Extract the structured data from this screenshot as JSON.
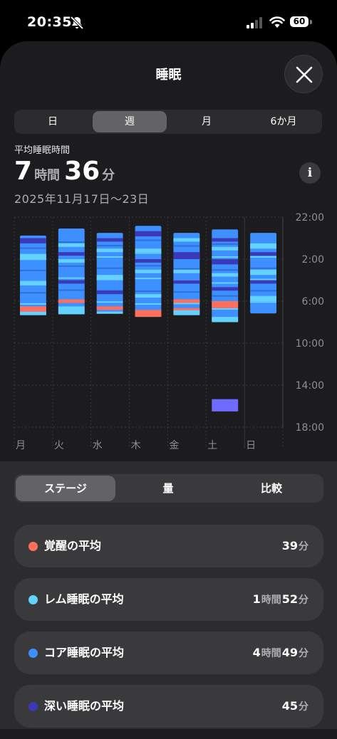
{
  "status_bar": {
    "time": "20:35",
    "battery": "60"
  },
  "header": {
    "title": "睡眠"
  },
  "period_tabs": [
    "日",
    "週",
    "月",
    "6か月"
  ],
  "summary": {
    "label": "平均睡眠時間",
    "hours": "7",
    "hours_unit": "時間",
    "minutes": "36",
    "minutes_unit": "分",
    "date_range": "2025年11月17日〜23日"
  },
  "chart_data": {
    "type": "bar",
    "categories": [
      "月",
      "火",
      "水",
      "木",
      "金",
      "土",
      "日"
    ],
    "y_ticks": [
      "22:00",
      "2:00",
      "6:00",
      "10:00",
      "14:00",
      "18:00"
    ],
    "ylim": [
      "22:00",
      "20:00"
    ],
    "series": [
      {
        "stage": "awake",
        "color": "#ff6f5b"
      },
      {
        "stage": "rem",
        "color": "#64d2ff"
      },
      {
        "stage": "core",
        "color": "#3e8fff"
      },
      {
        "stage": "deep",
        "color": "#3a3ab8"
      }
    ],
    "sessions": [
      {
        "day": "月",
        "start": "23:45",
        "end": "7:20",
        "awake": [
          "6:30-7:00"
        ],
        "rem": [
          "1:30-2:00",
          "4:10-4:30",
          "7:00-7:20"
        ],
        "deep": [
          "0:00-0:30"
        ]
      },
      {
        "day": "火",
        "start": "23:05",
        "end": "7:15",
        "awake": [
          "5:50-6:10"
        ],
        "rem": [
          "0:30-0:50",
          "2:00-2:20",
          "6:30-7:15"
        ],
        "deep": [
          "1:20-1:40",
          "4:00-4:20"
        ]
      },
      {
        "day": "水",
        "start": "23:30",
        "end": "7:10",
        "awake": [
          "6:30-6:50"
        ],
        "rem": [
          "1:00-1:20",
          "3:30-4:00",
          "7:00-7:10"
        ],
        "deep": [
          "0:00-0:20",
          "5:00-5:20"
        ]
      },
      {
        "day": "木",
        "start": "22:50",
        "end": "7:30",
        "awake": [
          "6:50-7:30"
        ],
        "rem": [
          "1:00-1:20",
          "3:00-3:20",
          "5:20-5:40"
        ],
        "deep": [
          "23:20-23:50",
          "2:00-2:20"
        ]
      },
      {
        "day": "金",
        "start": "23:30",
        "end": "7:20",
        "awake": [
          "5:50-6:10",
          "6:40-6:50"
        ],
        "rem": [
          "0:00-0:20",
          "3:00-3:20",
          "6:50-7:20"
        ],
        "deep": [
          "1:20-2:00",
          "4:00-4:20"
        ]
      },
      {
        "day": "土",
        "start": "23:10",
        "end": "8:00",
        "awake": [
          "6:00-6:40"
        ],
        "rem": [
          "0:50-1:10",
          "3:20-3:40",
          "7:30-8:00"
        ],
        "deep": [
          "0:00-0:20",
          "2:00-2:30",
          "4:40-5:00"
        ],
        "extra": {
          "start": "15:20",
          "end": "16:30",
          "stage": "nap"
        }
      },
      {
        "day": "日",
        "start": "23:30",
        "end": "7:10",
        "awake": [],
        "rem": [
          "0:30-1:00",
          "3:00-3:30",
          "5:30-6:00"
        ],
        "deep": [
          "1:20-1:40",
          "4:00-4:20"
        ]
      }
    ]
  },
  "view_tabs": [
    "ステージ",
    "量",
    "比較"
  ],
  "stages": [
    {
      "label": "覚醒の平均",
      "color": "#ff6f5b",
      "value_parts": [
        {
          "n": "39"
        },
        {
          "u": "分"
        }
      ]
    },
    {
      "label": "レム睡眠の平均",
      "color": "#64d2ff",
      "value_parts": [
        {
          "n": "1"
        },
        {
          "u": "時間"
        },
        {
          "n": "52"
        },
        {
          "u": "分"
        }
      ]
    },
    {
      "label": "コア睡眠の平均",
      "color": "#3e8fff",
      "value_parts": [
        {
          "n": "4"
        },
        {
          "u": "時間"
        },
        {
          "n": "49"
        },
        {
          "u": "分"
        }
      ]
    },
    {
      "label": "深い睡眠の平均",
      "color": "#3a3ab8",
      "value_parts": [
        {
          "n": "45"
        },
        {
          "u": "分"
        }
      ]
    }
  ]
}
